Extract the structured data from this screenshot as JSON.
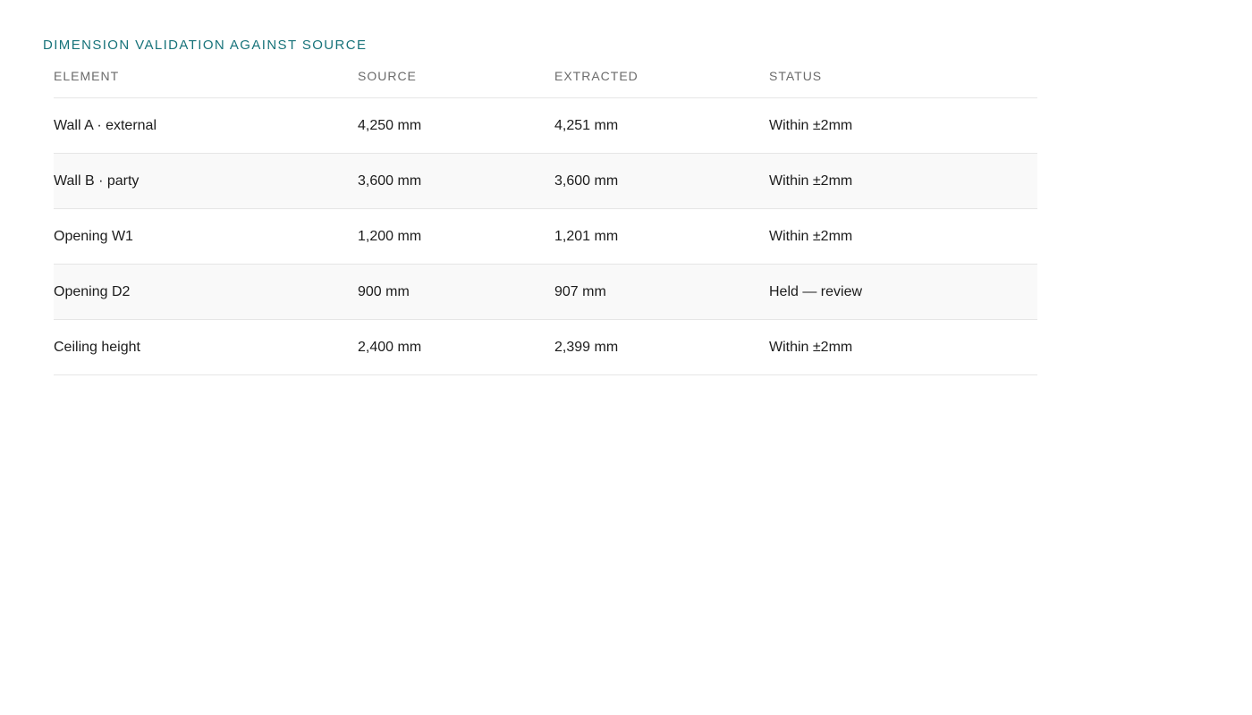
{
  "section": {
    "title": "DIMENSION VALIDATION AGAINST SOURCE"
  },
  "table": {
    "columns": [
      "ELEMENT",
      "SOURCE",
      "EXTRACTED",
      "STATUS"
    ],
    "rows": [
      {
        "element": "Wall A · external",
        "source": "4,250 mm",
        "extracted": "4,251 mm",
        "status": "Within ±2mm"
      },
      {
        "element": "Wall B · party",
        "source": "3,600 mm",
        "extracted": "3,600 mm",
        "status": "Within ±2mm"
      },
      {
        "element": "Opening W1",
        "source": "1,200 mm",
        "extracted": "1,201 mm",
        "status": "Within ±2mm"
      },
      {
        "element": "Opening D2",
        "source": "900 mm",
        "extracted": "907 mm",
        "status": "Held — review"
      },
      {
        "element": "Ceiling height",
        "source": "2,400 mm",
        "extracted": "2,399 mm",
        "status": "Within ±2mm"
      }
    ]
  },
  "colors": {
    "accent": "#17737a",
    "header_text": "#6b6b6b",
    "row_alt": "#f9f9f9",
    "divider": "#e6e6e6"
  }
}
